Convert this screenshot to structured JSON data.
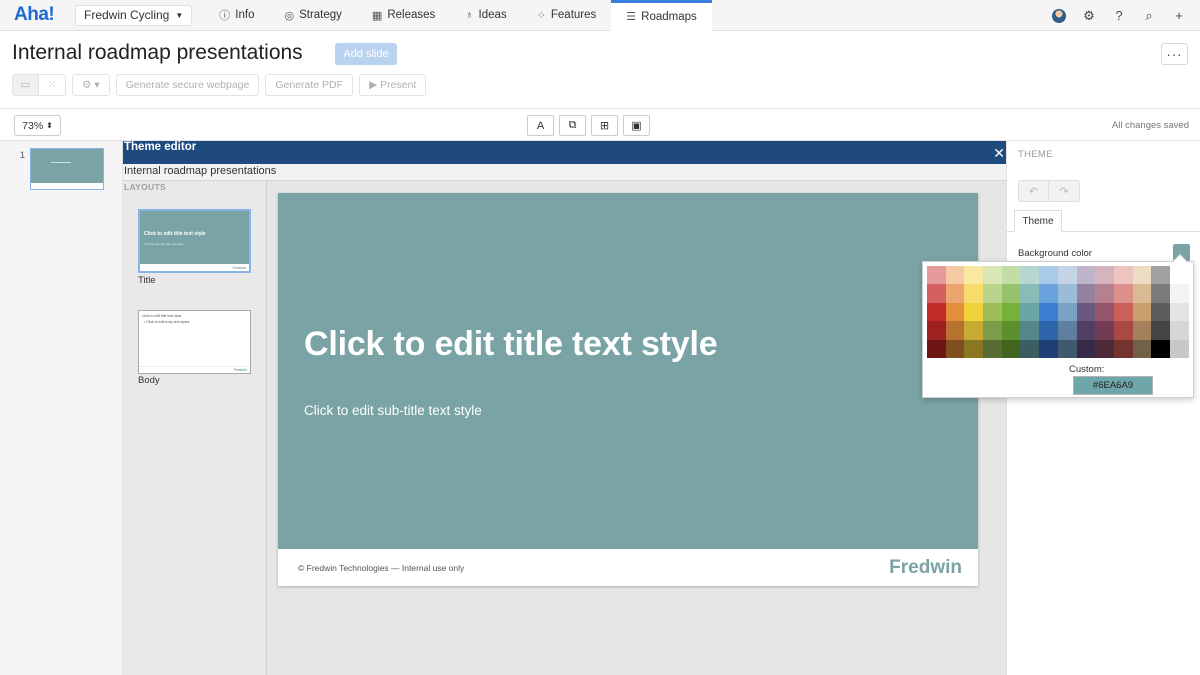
{
  "nav": {
    "logo": "Aha!",
    "workspace": "Fredwin Cycling",
    "tabs": [
      {
        "label": "Info",
        "icon": "info-icon",
        "glyph": "ⓘ"
      },
      {
        "label": "Strategy",
        "icon": "target-icon",
        "glyph": "◎"
      },
      {
        "label": "Releases",
        "icon": "calendar-icon",
        "glyph": "▦"
      },
      {
        "label": "Ideas",
        "icon": "lightbulb-icon",
        "glyph": "♁"
      },
      {
        "label": "Features",
        "icon": "grid-icon",
        "glyph": "⁘"
      },
      {
        "label": "Roadmaps",
        "icon": "roadmap-icon",
        "glyph": "☰"
      }
    ],
    "active_tab": "Roadmaps"
  },
  "header": {
    "title": "Internal roadmap presentations",
    "add_slide": "Add slide",
    "more": "···"
  },
  "toolbar": {
    "generate_webpage": "Generate secure webpage",
    "generate_pdf": "Generate PDF",
    "present": "Present"
  },
  "secondary": {
    "zoom": "73%",
    "saved_status": "All changes saved",
    "insert_tools": [
      {
        "name": "insert-text-button",
        "glyph": "A"
      },
      {
        "name": "insert-shape-button",
        "glyph": "⧉"
      },
      {
        "name": "insert-table-button",
        "glyph": "⊞"
      },
      {
        "name": "insert-image-button",
        "glyph": "▣"
      }
    ]
  },
  "slides": [
    {
      "number": "1"
    }
  ],
  "theme_editor": {
    "title": "Theme editor",
    "presentation_name": "Internal roadmap presentations",
    "layouts_label": "LAYOUTS",
    "layouts": [
      {
        "name": "Title",
        "thumb_title": "Click to edit title text style",
        "thumb_sub": "Click to edit sub-title text style"
      },
      {
        "name": "Body",
        "thumb_title": "Click to edit title text style",
        "thumb_sub": "• Click to edit body text styles"
      }
    ]
  },
  "slide": {
    "title": "Click to edit title text style",
    "subtitle": "Click to edit sub-title text style",
    "footer_text": "© Fredwin Technologies — Internal use only",
    "brand": "Fredwin",
    "background_color": "#7AA3A5"
  },
  "right_panel": {
    "heading": "THEME",
    "tab": "Theme",
    "background_color_label": "Background color"
  },
  "color_picker": {
    "custom_label": "Custom:",
    "custom_value": "#6EA6A9",
    "palette": [
      [
        "#e4999a",
        "#f4c9a3",
        "#fae8a0",
        "#d8e6b3",
        "#c2dea5",
        "#b6d6d2",
        "#a9cbe9",
        "#c3d4e6",
        "#bfb4c9",
        "#d5b4be",
        "#edc4c0",
        "#ecdcc2",
        "#a0a0a0",
        "#ffffff"
      ],
      [
        "#d3605f",
        "#eba66f",
        "#f7dc6b",
        "#b9d38a",
        "#95c26a",
        "#8abcb7",
        "#6aa2dd",
        "#9bbcd7",
        "#93819f",
        "#b6818f",
        "#dd908b",
        "#d9bb93",
        "#7b7b7b",
        "#f3f3f3"
      ],
      [
        "#c22c28",
        "#e38e3c",
        "#f2d23c",
        "#9cbf5b",
        "#76b239",
        "#69a6a5",
        "#3c7fd1",
        "#7aa2c6",
        "#6b5880",
        "#94546a",
        "#cb6058",
        "#c8a06c",
        "#5d5d5d",
        "#e4e4e4"
      ],
      [
        "#9f211f",
        "#b87230",
        "#c7aa31",
        "#7d9b48",
        "#5e8f2d",
        "#55878a",
        "#2f65ab",
        "#5e7f9f",
        "#523f66",
        "#733c52",
        "#a84a43",
        "#a4815a",
        "#444444",
        "#d6d6d6"
      ],
      [
        "#6e1515",
        "#7f4f22",
        "#8a7722",
        "#566c32",
        "#41641f",
        "#3a5e61",
        "#203f74",
        "#41586f",
        "#382b48",
        "#4f2a38",
        "#73332e",
        "#726048",
        "#000000",
        "#c8c8c8"
      ]
    ]
  }
}
